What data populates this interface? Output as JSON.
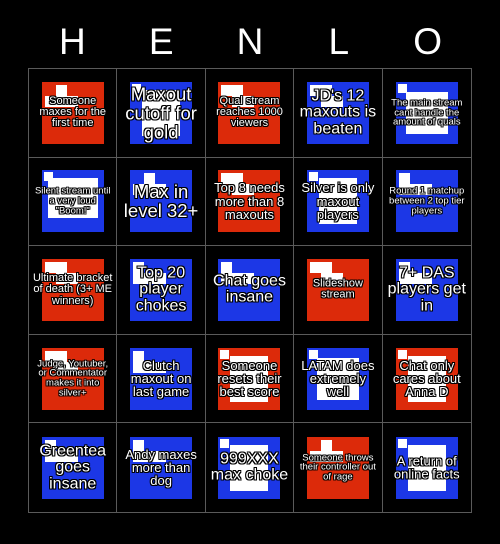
{
  "card": {
    "title_letters": [
      "H",
      "E",
      "N",
      "L",
      "O"
    ],
    "colors": {
      "background": "#000000",
      "red_tile": "#dc2a0a",
      "blue_tile": "#1c37e6",
      "tile_pattern": "#ffffff",
      "text": "#ffffff",
      "grid_line": "#5a5a5a"
    },
    "grid": {
      "columns": 5,
      "rows": 5
    },
    "cells": [
      {
        "text": "Someone maxes for the first time",
        "tile": "red",
        "piece": "t-piece",
        "size": "fs-s"
      },
      {
        "text": "Maxout cutoff for gold",
        "tile": "blue",
        "piece": "i-piece",
        "size": "fs-xl"
      },
      {
        "text": "Qual stream reaches 1000 viewers",
        "tile": "red",
        "piece": "s-piece",
        "size": "fs-s"
      },
      {
        "text": "JD's 12 maxouts is beaten",
        "tile": "blue",
        "piece": "s-piece",
        "size": "fs-l"
      },
      {
        "text": "The main stream cant handle the amount of quals",
        "tile": "blue",
        "piece": "o-piece",
        "size": "fs-xs"
      },
      {
        "text": "Silent stream until a very loud \"Boom!\"",
        "tile": "blue",
        "piece": "o-wide",
        "size": "fs-xs"
      },
      {
        "text": "Max in level 32+",
        "tile": "blue",
        "piece": "t-piece",
        "size": "fs-xl"
      },
      {
        "text": "Top 8 needs more than 8 maxouts",
        "tile": "red",
        "piece": "s-piece",
        "size": "fs-m"
      },
      {
        "text": "Silver is only maxout players",
        "tile": "blue",
        "piece": "i-piece",
        "size": "fs-m"
      },
      {
        "text": "Round 1 matchup between 2 top tier players",
        "tile": "blue",
        "piece": "j-piece",
        "size": "fs-xs"
      },
      {
        "text": "Ultimate bracket of death (3+ ME winners)",
        "tile": "red",
        "piece": "s-piece",
        "size": "fs-s"
      },
      {
        "text": "Top 20 player chokes",
        "tile": "blue",
        "piece": "j-piece",
        "size": "fs-l"
      },
      {
        "text": "Chat goes insane",
        "tile": "blue",
        "piece": "j-piece",
        "size": "fs-l"
      },
      {
        "text": "Slideshow stream",
        "tile": "red",
        "piece": "s-piece",
        "size": "fs-s"
      },
      {
        "text": "7+ DAS players get in",
        "tile": "blue",
        "piece": "j-piece",
        "size": "fs-l"
      },
      {
        "text": "Judge, Youtuber, or Commentator makes it into silver+",
        "tile": "red",
        "piece": "s-piece",
        "size": "fs-xs"
      },
      {
        "text": "Clutch maxout on last game",
        "tile": "blue",
        "piece": "j-piece",
        "size": "fs-m"
      },
      {
        "text": "Someone resets their best score",
        "tile": "red",
        "piece": "i-piece",
        "size": "fs-m"
      },
      {
        "text": "LATAM does extremely well",
        "tile": "blue",
        "piece": "o-piece",
        "size": "fs-m"
      },
      {
        "text": "Chat only cares about Anna D",
        "tile": "red",
        "piece": "i-piece",
        "size": "fs-m"
      },
      {
        "text": "Greentea goes insane",
        "tile": "blue",
        "piece": "j-piece",
        "size": "fs-l"
      },
      {
        "text": "Andy maxes more than dog",
        "tile": "blue",
        "piece": "j-piece",
        "size": "fs-m"
      },
      {
        "text": "999XXX max choke",
        "tile": "blue",
        "piece": "i-piece",
        "size": "fs-l"
      },
      {
        "text": "Someone throws their controller out of rage",
        "tile": "red",
        "piece": "t-piece",
        "size": "fs-xs"
      },
      {
        "text": "A return of online facts",
        "tile": "blue",
        "piece": "i-piece",
        "size": "fs-m"
      }
    ]
  }
}
